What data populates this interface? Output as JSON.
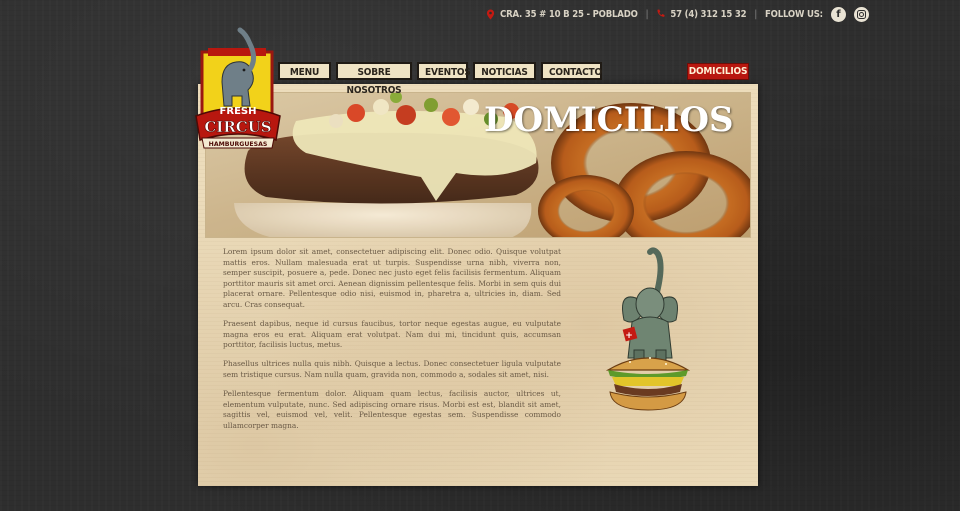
{
  "contact": {
    "address": "CRA. 35 # 10 B 25 - POBLADO",
    "phone": "57 (4) 312 15 32",
    "follow_label": "FOLLOW US:",
    "facebook_glyph": "f"
  },
  "brand": {
    "logo_word1": "FRESH",
    "logo_word2": "CIRCUS",
    "logo_word3": "HAMBURGUESAS"
  },
  "nav": {
    "items": [
      {
        "label": "MENU"
      },
      {
        "label": "SOBRE NOSOTROS"
      },
      {
        "label": "EVENTOS"
      },
      {
        "label": "NOTICIAS"
      },
      {
        "label": "CONTACTO"
      }
    ],
    "domicilios_label": "DOMICILIOS"
  },
  "page": {
    "hero_title": "DOMICILIOS",
    "paragraphs": [
      "Lorem ipsum dolor sit amet, consectetuer adipiscing elit. Donec odio. Quisque volutpat mattis eros. Nullam malesuada erat ut turpis. Suspendisse urna nibh, viverra non, semper suscipit, posuere a, pede. Donec nec justo eget felis facilisis fermentum. Aliquam porttitor mauris sit amet orci. Aenean dignissim pellentesque felis. Morbi in sem quis dui placerat ornare. Pellentesque odio nisi, euismod in, pharetra a, ultricies in, diam. Sed arcu. Cras consequat.",
      "Praesent dapibus, neque id cursus faucibus, tortor neque egestas augue, eu vulputate magna eros eu erat. Aliquam erat volutpat. Nam dui mi, tincidunt quis, accumsan porttitor, facilisis luctus, metus.",
      "Phasellus ultrices nulla quis nibh. Quisque a lectus. Donec consectetuer ligula vulputate sem tristique cursus. Nam nulla quam, gravida non, commodo a, sodales sit amet, nisi.",
      "Pellentesque fermentum dolor. Aliquam quam lectus, facilisis auctor, ultrices ut, elementum vulputate, nunc. Sed adipiscing ornare risus. Morbi est est, blandit sit amet, sagittis vel, euismod vel, velit. Pellentesque egestas sem. Suspendisse commodo ullamcorper magna."
    ]
  },
  "colors": {
    "background": "#2e2e2e",
    "paper": "#ecdcbb",
    "nav_bg": "#efe3c4",
    "accent_red": "#b8170f",
    "logo_yellow": "#f2d21a"
  },
  "icons": [
    "location-pin-icon",
    "phone-icon",
    "facebook-icon",
    "instagram-icon"
  ]
}
